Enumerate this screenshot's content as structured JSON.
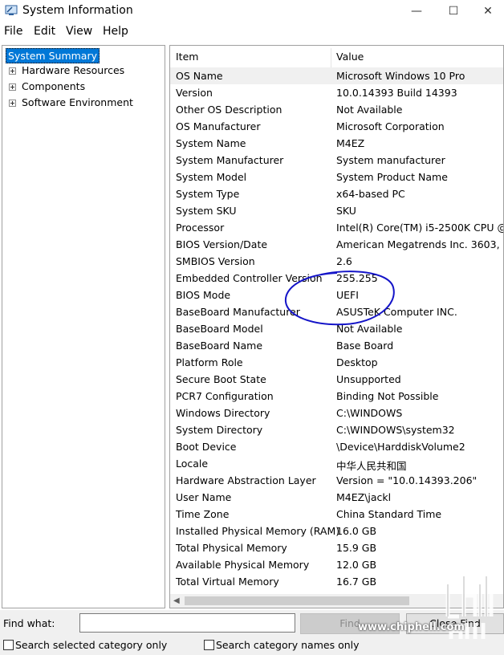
{
  "window": {
    "title": "System Information",
    "controls": {
      "minimize": "—",
      "maximize": "☐",
      "close": "✕"
    }
  },
  "menu": [
    "File",
    "Edit",
    "View",
    "Help"
  ],
  "tree": {
    "selected": "System Summary",
    "items": [
      "Hardware Resources",
      "Components",
      "Software Environment"
    ]
  },
  "list": {
    "headers": {
      "item": "Item",
      "value": "Value"
    },
    "rows": [
      {
        "item": "OS Name",
        "value": "Microsoft Windows 10 Pro"
      },
      {
        "item": "Version",
        "value": "10.0.14393 Build 14393"
      },
      {
        "item": "Other OS Description",
        "value": "Not Available"
      },
      {
        "item": "OS Manufacturer",
        "value": "Microsoft Corporation"
      },
      {
        "item": "System Name",
        "value": "M4EZ"
      },
      {
        "item": "System Manufacturer",
        "value": "System manufacturer"
      },
      {
        "item": "System Model",
        "value": "System Product Name"
      },
      {
        "item": "System Type",
        "value": "x64-based PC"
      },
      {
        "item": "System SKU",
        "value": "SKU"
      },
      {
        "item": "Processor",
        "value": "Intel(R) Core(TM) i5-2500K CPU @"
      },
      {
        "item": "BIOS Version/Date",
        "value": "American Megatrends Inc. 3603, "
      },
      {
        "item": "SMBIOS Version",
        "value": "2.6"
      },
      {
        "item": "Embedded Controller Version",
        "value": "255.255"
      },
      {
        "item": "BIOS Mode",
        "value": "UEFI"
      },
      {
        "item": "BaseBoard Manufacturer",
        "value": "ASUSTeK Computer INC."
      },
      {
        "item": "BaseBoard Model",
        "value": "Not Available"
      },
      {
        "item": "BaseBoard Name",
        "value": "Base Board"
      },
      {
        "item": "Platform Role",
        "value": "Desktop"
      },
      {
        "item": "Secure Boot State",
        "value": "Unsupported"
      },
      {
        "item": "PCR7 Configuration",
        "value": "Binding Not Possible"
      },
      {
        "item": "Windows Directory",
        "value": "C:\\WINDOWS"
      },
      {
        "item": "System Directory",
        "value": "C:\\WINDOWS\\system32"
      },
      {
        "item": "Boot Device",
        "value": "\\Device\\HarddiskVolume2"
      },
      {
        "item": "Locale",
        "value": "中华人民共和国"
      },
      {
        "item": "Hardware Abstraction Layer",
        "value": "Version = \"10.0.14393.206\""
      },
      {
        "item": "User Name",
        "value": "M4EZ\\jackl"
      },
      {
        "item": "Time Zone",
        "value": "China Standard Time"
      },
      {
        "item": "Installed Physical Memory (RAM)",
        "value": "16.0 GB"
      },
      {
        "item": "Total Physical Memory",
        "value": "15.9 GB"
      },
      {
        "item": "Available Physical Memory",
        "value": "12.0 GB"
      },
      {
        "item": "Total Virtual Memory",
        "value": "16.7 GB"
      }
    ]
  },
  "find": {
    "label": "Find what:",
    "value": "",
    "find_button": "Find",
    "close_button": "Close Find",
    "search_selected": "Search selected category only",
    "search_names": "Search category names only"
  },
  "watermark": {
    "text": "www.chiphell.com"
  }
}
